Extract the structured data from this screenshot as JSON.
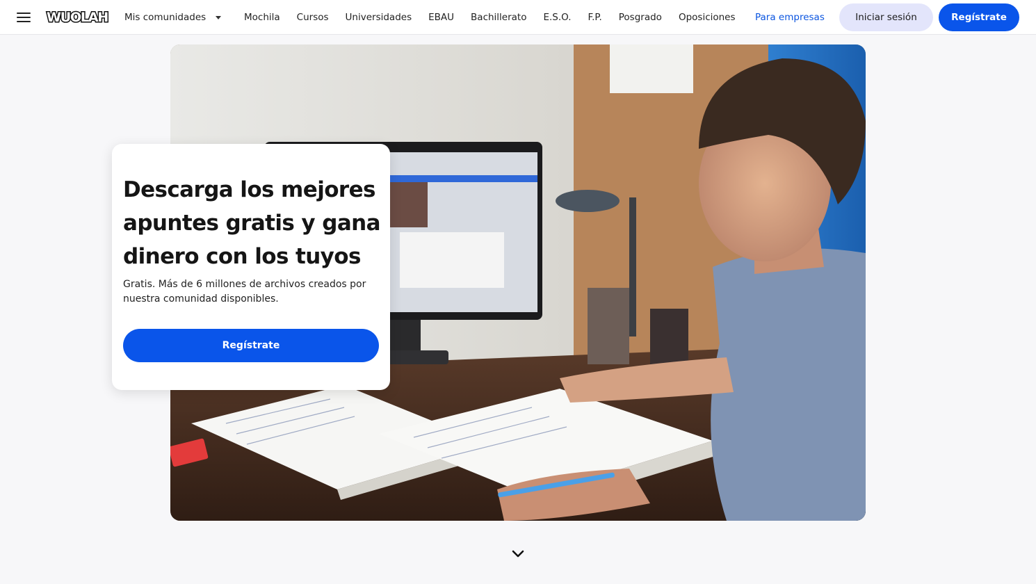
{
  "header": {
    "logo_text": "WUOLAH",
    "communities_label": "Mis comunidades",
    "nav_items": [
      {
        "label": "Mochila"
      },
      {
        "label": "Cursos"
      },
      {
        "label": "Universidades"
      },
      {
        "label": "EBAU"
      },
      {
        "label": "Bachillerato"
      },
      {
        "label": "E.S.O."
      },
      {
        "label": "F.P."
      },
      {
        "label": "Posgrado"
      },
      {
        "label": "Oposiciones"
      }
    ],
    "business_link": "Para empresas",
    "login_label": "Iniciar sesión",
    "signup_label": "Regístrate"
  },
  "hero": {
    "title": "Descarga los mejores apuntes gratis y gana dinero con los tuyos",
    "subtitle": "Gratis. Más de 6 millones de archivos creados por nuestra comunidad disponibles.",
    "cta_label": "Regístrate"
  },
  "icons": {
    "menu": "hamburger-menu-icon",
    "caret": "caret-down-icon",
    "scroll": "chevron-down-icon"
  },
  "colors": {
    "primary": "#0a55ea",
    "login_bg": "#e3e5fb",
    "link": "#0b55e0",
    "page_bg": "#f7f7f9"
  }
}
